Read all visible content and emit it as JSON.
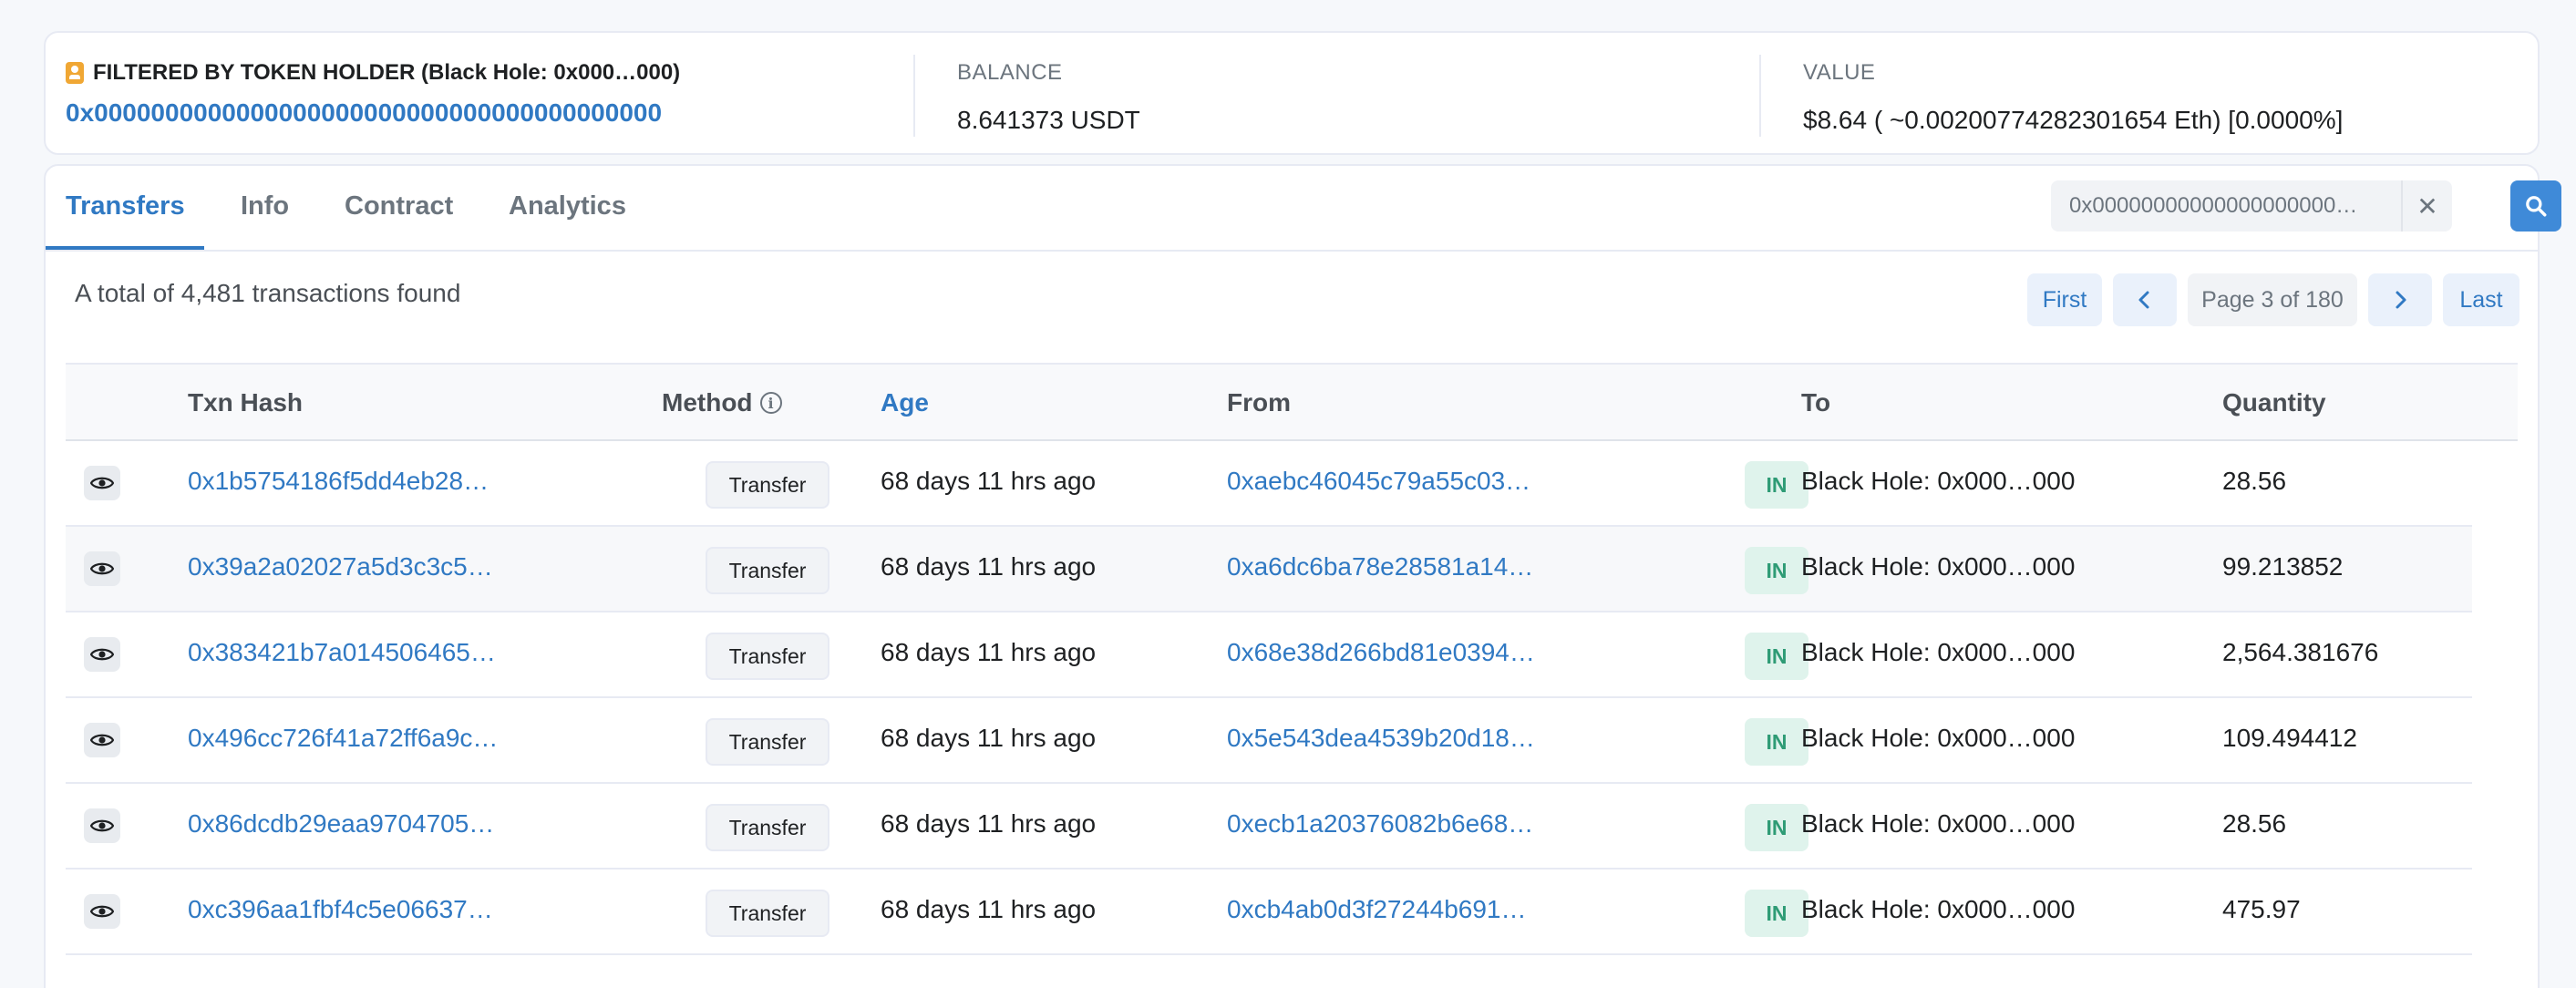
{
  "summary": {
    "holder_label": "FILTERED BY TOKEN HOLDER (Black Hole: 0x000…000)",
    "holder_address": "0x0000000000000000000000000000000000000000",
    "balance_title": "BALANCE",
    "balance_value": "8.641373 USDT",
    "value_title": "VALUE",
    "value_value": "$8.64 ( ~0.00200774282301654 Eth) [0.0000%]"
  },
  "tabs": [
    {
      "label": "Transfers",
      "active": true
    },
    {
      "label": "Info",
      "active": false
    },
    {
      "label": "Contract",
      "active": false
    },
    {
      "label": "Analytics",
      "active": false
    }
  ],
  "search": {
    "value": "0x00000000000000000000…",
    "clear_icon": "close-icon",
    "button_icon": "search-icon"
  },
  "total_text": "A total of 4,481 transactions found",
  "pager": {
    "first": "First",
    "prev_icon": "chevron-left-icon",
    "page_info": "Page 3 of 180",
    "next_icon": "chevron-right-icon",
    "last": "Last"
  },
  "table": {
    "headers": {
      "txn_hash": "Txn Hash",
      "method": "Method",
      "age": "Age",
      "from": "From",
      "to": "To",
      "quantity": "Quantity"
    },
    "rows": [
      {
        "hash": "0x1b5754186f5dd4eb28…",
        "method": "Transfer",
        "age": "68 days 11 hrs ago",
        "from": "0xaebc46045c79a55c03…",
        "direction": "IN",
        "to": "Black Hole: 0x000…000",
        "quantity": "28.56"
      },
      {
        "hash": "0x39a2a02027a5d3c3c5…",
        "method": "Transfer",
        "age": "68 days 11 hrs ago",
        "from": "0xa6dc6ba78e28581a14…",
        "direction": "IN",
        "to": "Black Hole: 0x000…000",
        "quantity": "99.213852"
      },
      {
        "hash": "0x383421b7a014506465…",
        "method": "Transfer",
        "age": "68 days 11 hrs ago",
        "from": "0x68e38d266bd81e0394…",
        "direction": "IN",
        "to": "Black Hole: 0x000…000",
        "quantity": "2,564.381676"
      },
      {
        "hash": "0x496cc726f41a72ff6a9c…",
        "method": "Transfer",
        "age": "68 days 11 hrs ago",
        "from": "0x5e543dea4539b20d18…",
        "direction": "IN",
        "to": "Black Hole: 0x000…000",
        "quantity": "109.494412"
      },
      {
        "hash": "0x86dcdb29eaa9704705…",
        "method": "Transfer",
        "age": "68 days 11 hrs ago",
        "from": "0xecb1a20376082b6e68…",
        "direction": "IN",
        "to": "Black Hole: 0x000…000",
        "quantity": "28.56"
      },
      {
        "hash": "0xc396aa1fbf4c5e06637…",
        "method": "Transfer",
        "age": "68 days 11 hrs ago",
        "from": "0xcb4ab0d3f27244b691…",
        "direction": "IN",
        "to": "Black Hole: 0x000…000",
        "quantity": "475.97"
      }
    ]
  }
}
